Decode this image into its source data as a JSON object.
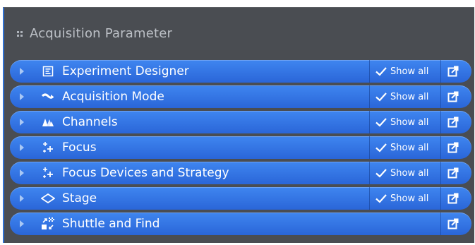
{
  "panel": {
    "title": "Acquisition Parameter",
    "items": [
      {
        "label": "Experiment Designer",
        "icon": "experiment-designer-icon",
        "show_all": "Show all"
      },
      {
        "label": "Acquisition Mode",
        "icon": "acquisition-mode-icon",
        "show_all": "Show all"
      },
      {
        "label": "Channels",
        "icon": "channels-icon",
        "show_all": "Show all"
      },
      {
        "label": "Focus",
        "icon": "focus-icon",
        "show_all": "Show all"
      },
      {
        "label": "Focus Devices and Strategy",
        "icon": "focus-devices-icon",
        "show_all": "Show all"
      },
      {
        "label": "Stage",
        "icon": "stage-icon",
        "show_all": "Show all"
      },
      {
        "label": "Shuttle and Find",
        "icon": "shuttle-find-icon",
        "show_all": ""
      }
    ]
  },
  "colors": {
    "panel_bg": "#4a4d52",
    "row_blue": "#3478e6",
    "title_gray": "#bcc0c6"
  }
}
